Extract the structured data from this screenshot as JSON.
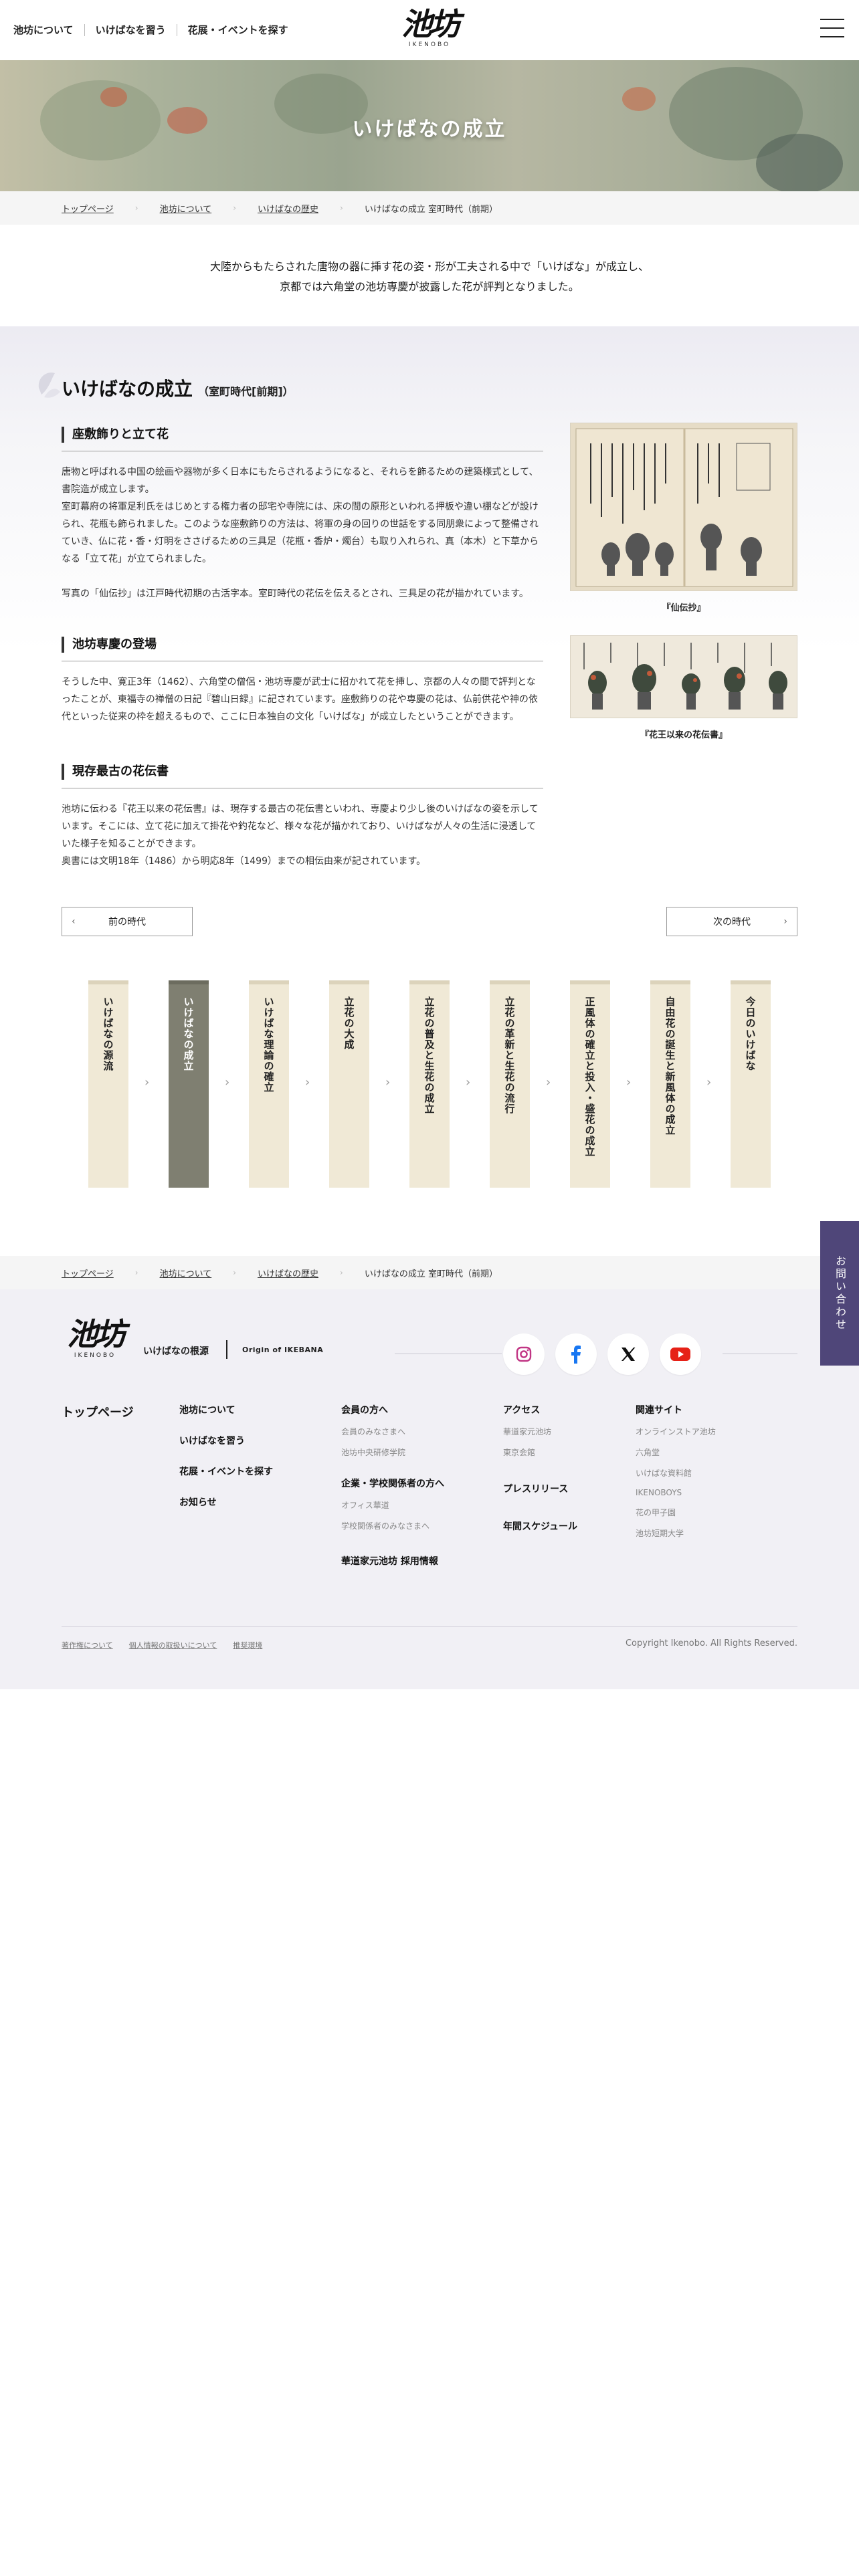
{
  "header": {
    "nav": [
      "池坊について",
      "いけばなを習う",
      "花展・イベントを探す"
    ],
    "logo_text": "池坊",
    "logo_romaji": "IKENOBO"
  },
  "hero": {
    "title": "いけばなの成立"
  },
  "breadcrumb": {
    "items": [
      "トップページ",
      "池坊について",
      "いけばなの歴史"
    ],
    "current": "いけばなの成立 室町時代（前期）"
  },
  "intro": {
    "line1": "大陸からもたらされた唐物の器に挿す花の姿・形が工夫される中で「いけばな」が成立し、",
    "line2": "京都では六角堂の池坊専慶が披露した花が評判となりました。"
  },
  "section": {
    "title": "いけばなの成立",
    "era": "（室町時代[前期]）"
  },
  "topics": [
    {
      "heading": "座敷飾りと立て花",
      "paragraphs": [
        "唐物と呼ばれる中国の絵画や器物が多く日本にもたらされるようになると、それらを飾るための建築様式として、書院造が成立します。",
        "室町幕府の将軍足利氏をはじめとする権力者の邸宅や寺院には、床の間の原形といわれる押板や違い棚などが設けられ、花瓶も飾られました。このような座敷飾りの方法は、将軍の身の回りの世話をする同朋衆によって整備されていき、仏に花・香・灯明をささげるための三具足（花瓶・香炉・燭台）も取り入れられ、真（本木）と下草からなる「立て花」が立てられました。",
        "写真の「仙伝抄」は江戸時代初期の古活字本。室町時代の花伝を伝えるとされ、三具足の花が描かれています。"
      ]
    },
    {
      "heading": "池坊専慶の登場",
      "paragraphs": [
        "そうした中、寛正3年（1462）、六角堂の僧侶・池坊専慶が武士に招かれて花を挿し、京都の人々の間で評判となったことが、東福寺の禅僧の日記『碧山日録』に記されています。座敷飾りの花や専慶の花は、仏前供花や神の依代といった従来の枠を超えるもので、ここに日本独自の文化「いけばな」が成立したということができます。"
      ]
    },
    {
      "heading": "現存最古の花伝書",
      "paragraphs": [
        "池坊に伝わる『花王以来の花伝書』は、現存する最古の花伝書といわれ、専慶より少し後のいけばなの姿を示しています。そこには、立て花に加えて掛花や釣花など、様々な花が描かれており、いけばなが人々の生活に浸透していた様子を知ることができます。",
        "奥書には文明18年（1486）から明応8年（1499）までの相伝由来が記されています。"
      ]
    }
  ],
  "figures": [
    {
      "caption": "『仙伝抄』"
    },
    {
      "caption": "『花王以来の花伝書』"
    }
  ],
  "pager": {
    "prev": "前の時代",
    "next": "次の時代"
  },
  "timeline": [
    {
      "label": "いけばなの源流",
      "active": false
    },
    {
      "label": "いけばなの成立",
      "active": true
    },
    {
      "label": "いけばな理論の確立",
      "active": false
    },
    {
      "label": "立花の大成",
      "active": false
    },
    {
      "label": "立花の普及と生花の成立",
      "active": false
    },
    {
      "label": "立花の革新と生花の流行",
      "active": false
    },
    {
      "label": "正風体の確立と投入・盛花の成立",
      "active": false
    },
    {
      "label": "自由花の誕生と新風体の成立",
      "active": false
    },
    {
      "label": "今日のいけばな",
      "active": false
    }
  ],
  "footer": {
    "tagline_jp": "いけばなの根源",
    "tagline_en": "Origin of IKEBANA",
    "social": [
      "instagram-icon",
      "facebook-icon",
      "x-icon",
      "youtube-icon"
    ],
    "top_link": "トップページ",
    "about": [
      "池坊について",
      "いけばなを習う",
      "花展・イベントを探す",
      "お知らせ"
    ],
    "members": {
      "title": "会員の方へ",
      "links": [
        "会員のみなさまへ",
        "池坊中央研修学院"
      ]
    },
    "corporate": {
      "title": "企業・学校関係者の方へ",
      "links": [
        "オフィス華道",
        "学校関係者のみなさまへ"
      ]
    },
    "recruit": "華道家元池坊 採用情報",
    "access": {
      "title": "アクセス",
      "links": [
        "華道家元池坊",
        "東京会館"
      ]
    },
    "press": "プレスリリース",
    "schedule": "年間スケジュール",
    "related": {
      "title": "関連サイト",
      "links": [
        "オンラインストア池坊",
        "六角堂",
        "いけばな資料館",
        "IKENOBOYS",
        "花の甲子園",
        "池坊短期大学"
      ]
    },
    "legal": [
      "著作権について",
      "個人情報の取扱いについて",
      "推奨環境"
    ],
    "copyright": "Copyright Ikenobo. All Rights Reserved."
  },
  "contact_tab": "お問い合わせ",
  "colors": {
    "active_card": "#7f7f71",
    "card": "#f0e9d6",
    "contact": "#4f4679",
    "footer_bg": "#f1f0f5",
    "instagram": "#c13584",
    "facebook": "#1877f2",
    "youtube": "#e62117"
  }
}
